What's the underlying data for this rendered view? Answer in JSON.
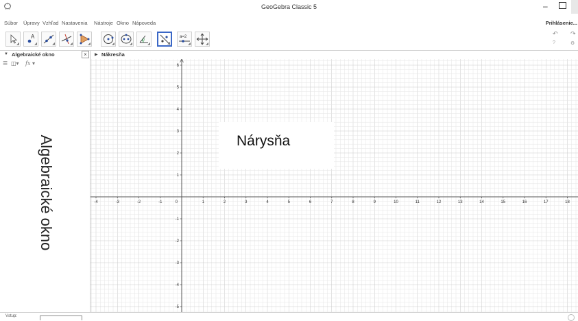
{
  "window": {
    "title": "GeoGebra Classic 5",
    "app_icon": "geogebra-logo-icon"
  },
  "menu": {
    "items": [
      "Súbor",
      "Úpravy",
      "Vzhľad",
      "Nastavenia",
      "Nástroje",
      "Okno",
      "Nápoveda"
    ],
    "login": "Prihlásenie..."
  },
  "toolbar": {
    "tools": [
      {
        "name": "move-tool-icon"
      },
      {
        "name": "point-tool-icon"
      },
      {
        "name": "line-tool-icon"
      },
      {
        "name": "perpendicular-line-tool-icon"
      },
      {
        "name": "polygon-tool-icon"
      },
      {
        "name": "circle-center-point-tool-icon"
      },
      {
        "name": "ellipse-tool-icon"
      },
      {
        "name": "angle-tool-icon"
      },
      {
        "name": "reflect-tool-icon",
        "selected": true
      },
      {
        "name": "slider-tool-icon",
        "label": "a=2"
      },
      {
        "name": "move-graphics-view-tool-icon"
      }
    ],
    "undo_icon": "undo-icon",
    "redo_icon": "redo-icon",
    "accent": "#3a67c6"
  },
  "algebra": {
    "title": "Algebraické okno",
    "overlay_label": "Algebraické okno",
    "fx_label": "fx"
  },
  "graphics": {
    "title": "Nákresňa",
    "overlay_label": "Nárysňa",
    "x_ticks": [
      -4,
      -3,
      -2,
      -1,
      0,
      1,
      2,
      3,
      4,
      5,
      6,
      7,
      8,
      9,
      10,
      11,
      12,
      13,
      14,
      15,
      16,
      17,
      18
    ],
    "y_ticks": [
      6,
      5,
      4,
      3,
      2,
      1,
      -1,
      -2,
      -3,
      -4,
      -5
    ],
    "grid_color": "#e5e5e5",
    "major_grid_color": "#c9c9c9",
    "axis_color": "#555555"
  },
  "status": {
    "input_label": "Vstup:"
  }
}
